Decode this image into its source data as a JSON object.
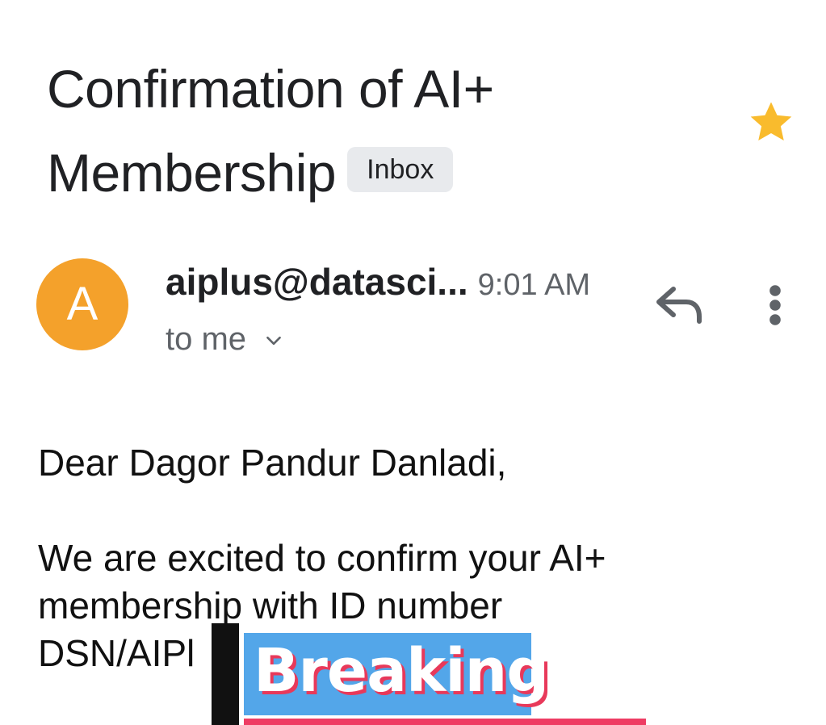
{
  "email": {
    "subject": "Confirmation of AI+ Membership",
    "label": "Inbox",
    "starred": true,
    "sender_initial": "A",
    "sender": "aiplus@datasci...",
    "time": "9:01 AM",
    "recipient": "to me",
    "greeting": "Dear Dagor Pandur Danladi,",
    "body_lines": [
      "We are excited to confirm your AI+",
      "membership with ID number",
      "DSN/AIPl"
    ]
  },
  "overlay": {
    "text": "Breaking"
  },
  "colors": {
    "star": "#f9bb2d",
    "avatar": "#f4a12b",
    "banner": "#53a6e9",
    "banner_shadow": "#e8395a",
    "underline": "#ee3c63"
  },
  "icons": {
    "star": "star-icon",
    "reply": "reply-icon",
    "more": "more-vert-icon",
    "expand": "chevron-down-icon"
  }
}
